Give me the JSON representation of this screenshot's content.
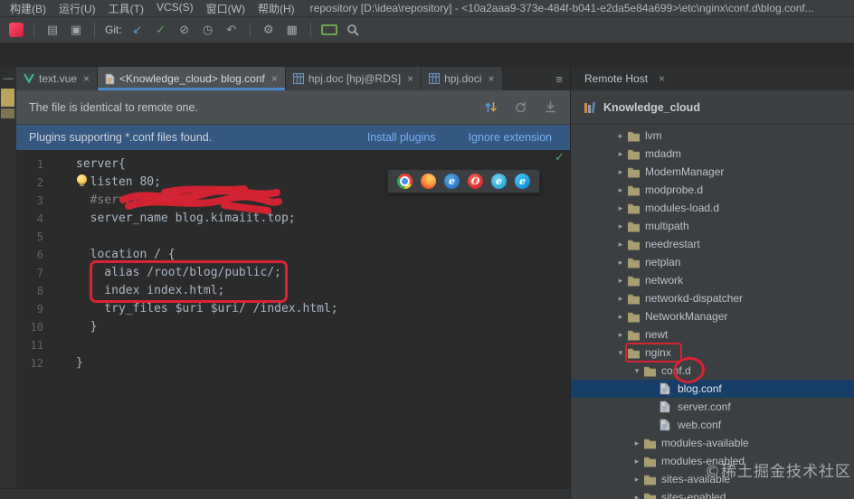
{
  "window": {
    "menus": [
      "构建(B)",
      "运行(U)",
      "工具(T)",
      "VCS(S)",
      "窗口(W)",
      "帮助(H)"
    ],
    "title": "repository [D:\\idea\\repository] - <10a2aaa9-373e-484f-b041-e2da5e84a699>\\etc\\nginx\\conf.d\\blog.conf..."
  },
  "toolbar": {
    "items": [
      {
        "type": "logo",
        "name": "app-logo"
      },
      {
        "type": "sep"
      },
      {
        "type": "icon",
        "name": "open-project",
        "glyph": "▤"
      },
      {
        "type": "icon",
        "name": "save-all",
        "glyph": "▣"
      },
      {
        "type": "sep"
      },
      {
        "type": "label",
        "name": "git-label",
        "text": "Git:"
      },
      {
        "type": "icon",
        "name": "update-project",
        "glyph": "↙",
        "color": "#549ed8"
      },
      {
        "type": "icon",
        "name": "commit",
        "glyph": "✓",
        "color": "#5ca85c"
      },
      {
        "type": "icon",
        "name": "rollback",
        "glyph": "⊘"
      },
      {
        "type": "icon",
        "name": "history",
        "glyph": "◷"
      },
      {
        "type": "icon",
        "name": "undo",
        "glyph": "↶"
      },
      {
        "type": "sep"
      },
      {
        "type": "icon",
        "name": "tools",
        "glyph": "⚙"
      },
      {
        "type": "icon",
        "name": "project-structure",
        "glyph": "▦"
      },
      {
        "type": "sep"
      },
      {
        "type": "terminal",
        "name": "run-console"
      },
      {
        "type": "search",
        "name": "search-everywhere"
      }
    ]
  },
  "ui": {
    "close_glyph": "×",
    "dash": "—",
    "list_icon": "≡",
    "collapsed_arrow": "▸",
    "expanded_arrow": "▾"
  },
  "editor_tabs": [
    {
      "label": "text.vue",
      "icon": "vue",
      "closable": true
    },
    {
      "label": "<Knowledge_cloud> blog.conf",
      "icon": "conf",
      "active": true,
      "closable": true
    },
    {
      "label": "hpj.doc [hpj@RDS]",
      "icon": "table",
      "closable": true
    },
    {
      "label": "hpj.doci",
      "icon": "table",
      "closable": true
    }
  ],
  "banners": {
    "sync": {
      "text": "The file is identical to remote one."
    },
    "plugins": {
      "text": "Plugins supporting *.conf files found.",
      "install": "Install plugins",
      "ignore": "Ignore extension"
    }
  },
  "code": {
    "inspection_icon": "✓",
    "lines": [
      {
        "n": 1,
        "t": "server{"
      },
      {
        "n": 2,
        "t": "  listen 80;",
        "bulb": true
      },
      {
        "n": 3,
        "t": "  #server_name ",
        "cls": "comment"
      },
      {
        "n": 4,
        "t": "  server_name blog.kimaiit.top;"
      },
      {
        "n": 5,
        "t": ""
      },
      {
        "n": 6,
        "t": "  location / {"
      },
      {
        "n": 7,
        "t": "    alias /root/blog/public/;"
      },
      {
        "n": 8,
        "t": "    index index.html;"
      },
      {
        "n": 9,
        "t": "    try_files $uri $uri/ /index.html;"
      },
      {
        "n": 10,
        "t": "  }"
      },
      {
        "n": 11,
        "t": ""
      },
      {
        "n": 12,
        "t": "}"
      }
    ]
  },
  "browser_icons": [
    {
      "name": "chrome"
    },
    {
      "name": "firefox"
    },
    {
      "name": "ie"
    },
    {
      "name": "opera"
    },
    {
      "name": "explorer"
    },
    {
      "name": "edge"
    }
  ],
  "right_panel": {
    "tab": "Remote Host",
    "root": "Knowledge_cloud",
    "items": [
      {
        "label": "lvm",
        "depth": 1,
        "type": "folder",
        "state": "collapsed"
      },
      {
        "label": "mdadm",
        "depth": 1,
        "type": "folder",
        "state": "collapsed"
      },
      {
        "label": "ModemManager",
        "depth": 1,
        "type": "folder",
        "state": "collapsed"
      },
      {
        "label": "modprobe.d",
        "depth": 1,
        "type": "folder",
        "state": "collapsed"
      },
      {
        "label": "modules-load.d",
        "depth": 1,
        "type": "folder",
        "state": "collapsed"
      },
      {
        "label": "multipath",
        "depth": 1,
        "type": "folder",
        "state": "collapsed"
      },
      {
        "label": "needrestart",
        "depth": 1,
        "type": "folder",
        "state": "collapsed"
      },
      {
        "label": "netplan",
        "depth": 1,
        "type": "folder",
        "state": "collapsed"
      },
      {
        "label": "network",
        "depth": 1,
        "type": "folder",
        "state": "collapsed"
      },
      {
        "label": "networkd-dispatcher",
        "depth": 1,
        "type": "folder",
        "state": "collapsed"
      },
      {
        "label": "NetworkManager",
        "depth": 1,
        "type": "folder",
        "state": "collapsed"
      },
      {
        "label": "newt",
        "depth": 1,
        "type": "folder",
        "state": "collapsed"
      },
      {
        "label": "nginx",
        "depth": 1,
        "type": "folder",
        "state": "expanded"
      },
      {
        "label": "conf.d",
        "depth": 2,
        "type": "folder",
        "state": "expanded"
      },
      {
        "label": "blog.conf",
        "depth": 3,
        "type": "file",
        "selected": true
      },
      {
        "label": "server.conf",
        "depth": 3,
        "type": "file"
      },
      {
        "label": "web.conf",
        "depth": 3,
        "type": "file"
      },
      {
        "label": "modules-available",
        "depth": 2,
        "type": "folder",
        "state": "collapsed"
      },
      {
        "label": "modules-enabled",
        "depth": 2,
        "type": "folder",
        "state": "collapsed"
      },
      {
        "label": "sites-available",
        "depth": 2,
        "type": "folder",
        "state": "collapsed"
      },
      {
        "label": "sites-enabled",
        "depth": 2,
        "type": "folder",
        "state": "collapsed"
      }
    ]
  },
  "watermark": "©稀土掘金技术社区",
  "colors": {
    "accent": "#4a88c7",
    "banner_info": "#355880",
    "tree_selection": "#173e66",
    "annotation": "#da2332",
    "link": "#7ab0f5"
  }
}
